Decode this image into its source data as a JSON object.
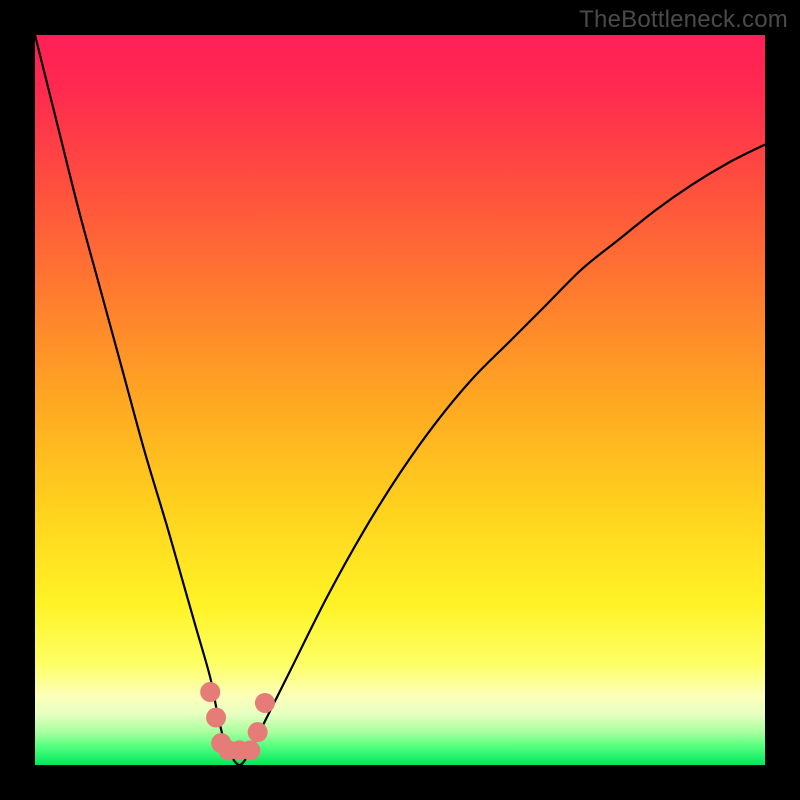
{
  "watermark": "TheBottleneck.com",
  "chart_data": {
    "type": "line",
    "title": "",
    "xlabel": "",
    "ylabel": "",
    "xlim": [
      0,
      100
    ],
    "ylim": [
      0,
      100
    ],
    "series": [
      {
        "name": "curve",
        "x": [
          0,
          3,
          6,
          9,
          12,
          15,
          18,
          20,
          22,
          24,
          25,
          26,
          27,
          28,
          29,
          30,
          32,
          35,
          40,
          45,
          50,
          55,
          60,
          65,
          70,
          75,
          80,
          85,
          90,
          95,
          100
        ],
        "values": [
          100,
          88,
          76,
          65,
          54,
          43,
          33,
          26,
          19,
          12,
          7,
          3,
          1,
          0,
          1,
          3,
          7,
          13,
          23,
          32,
          40,
          47,
          53,
          58,
          63,
          68,
          72,
          76,
          79.5,
          82.5,
          85
        ]
      }
    ],
    "highlight_points": [
      {
        "x": 24.0,
        "y": 10.0
      },
      {
        "x": 24.8,
        "y": 6.5
      },
      {
        "x": 25.5,
        "y": 3.0
      },
      {
        "x": 26.5,
        "y": 2.0
      },
      {
        "x": 28.0,
        "y": 2.0
      },
      {
        "x": 29.5,
        "y": 2.0
      },
      {
        "x": 30.5,
        "y": 4.5
      },
      {
        "x": 31.5,
        "y": 8.5
      }
    ],
    "gradient_stops": [
      {
        "offset": 0.0,
        "color": "#ff1f56"
      },
      {
        "offset": 0.08,
        "color": "#ff2b4f"
      },
      {
        "offset": 0.2,
        "color": "#ff4d3f"
      },
      {
        "offset": 0.35,
        "color": "#ff7a2f"
      },
      {
        "offset": 0.5,
        "color": "#ffa722"
      },
      {
        "offset": 0.65,
        "color": "#ffd21e"
      },
      {
        "offset": 0.78,
        "color": "#fff326"
      },
      {
        "offset": 0.86,
        "color": "#fdff63"
      },
      {
        "offset": 0.905,
        "color": "#fcffb8"
      },
      {
        "offset": 0.93,
        "color": "#e7ffc1"
      },
      {
        "offset": 0.955,
        "color": "#a8ff9e"
      },
      {
        "offset": 0.975,
        "color": "#52ff7e"
      },
      {
        "offset": 1.0,
        "color": "#00e75e"
      }
    ],
    "highlight_color": "#e67c78",
    "curve_color": "#000000"
  }
}
